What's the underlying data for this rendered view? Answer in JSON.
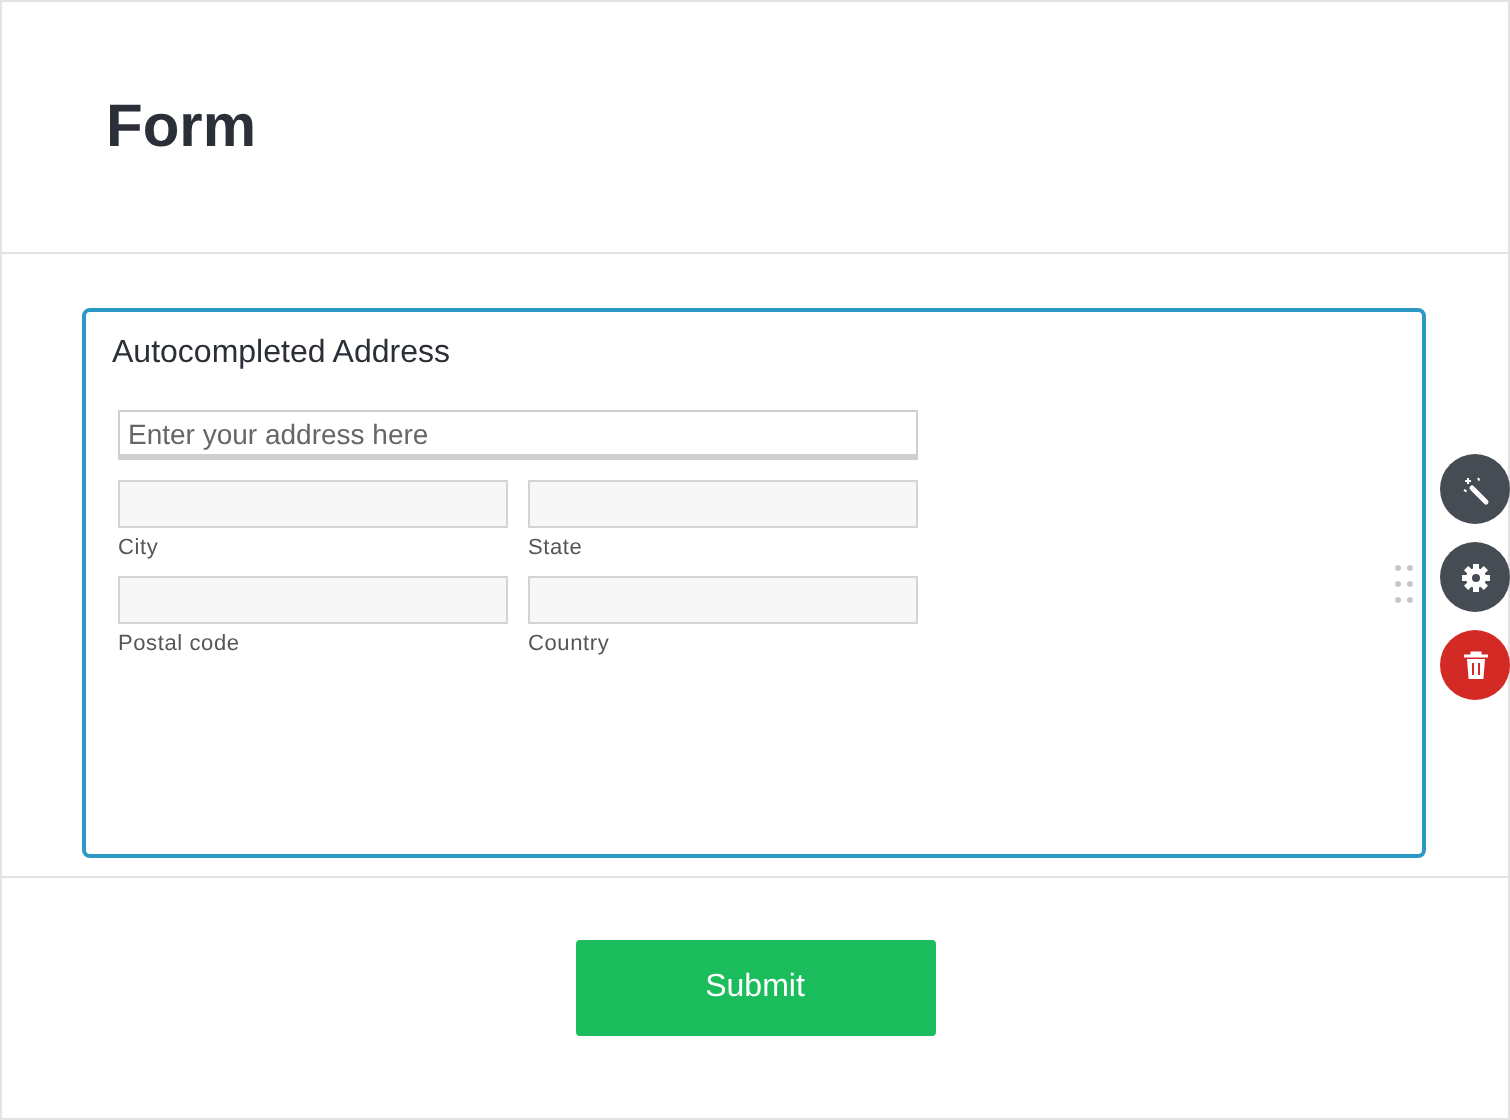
{
  "form": {
    "title": "Form"
  },
  "address_block": {
    "title": "Autocompleted Address",
    "address_field": {
      "placeholder": "Enter your address here"
    },
    "fields": [
      {
        "label": "City"
      },
      {
        "label": "State"
      },
      {
        "label": "Postal code"
      },
      {
        "label": "Country"
      }
    ]
  },
  "submit_button": "Submit"
}
